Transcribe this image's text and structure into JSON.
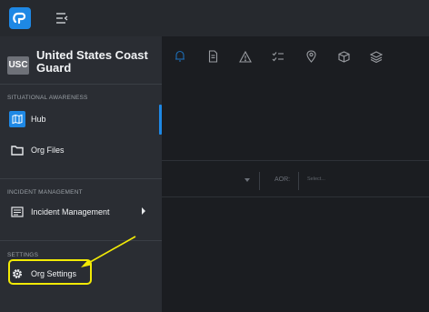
{
  "org": {
    "badge": "USC",
    "name": "United States Coast Guard"
  },
  "sections": {
    "situational": "SITUATIONAL AWARENESS",
    "incident": "INCIDENT MANAGEMENT",
    "settings": "SETTINGS"
  },
  "nav": {
    "hub": "Hub",
    "org_files": "Org Files",
    "incident_management": "Incident Management",
    "org_settings": "Org Settings"
  },
  "toolbar": {
    "icons": [
      "bell-icon",
      "document-icon",
      "warning-icon",
      "checklist-icon",
      "location-pin-icon",
      "package-icon",
      "layers-icon"
    ]
  },
  "filters": {
    "aor_label": "AOR:",
    "aor_placeholder": "Select..."
  },
  "colors": {
    "accent": "#1e88e5",
    "highlight": "#f2ea06",
    "sidebar": "#2a2d33",
    "topbar": "#26292e",
    "background": "#1b1d21"
  }
}
